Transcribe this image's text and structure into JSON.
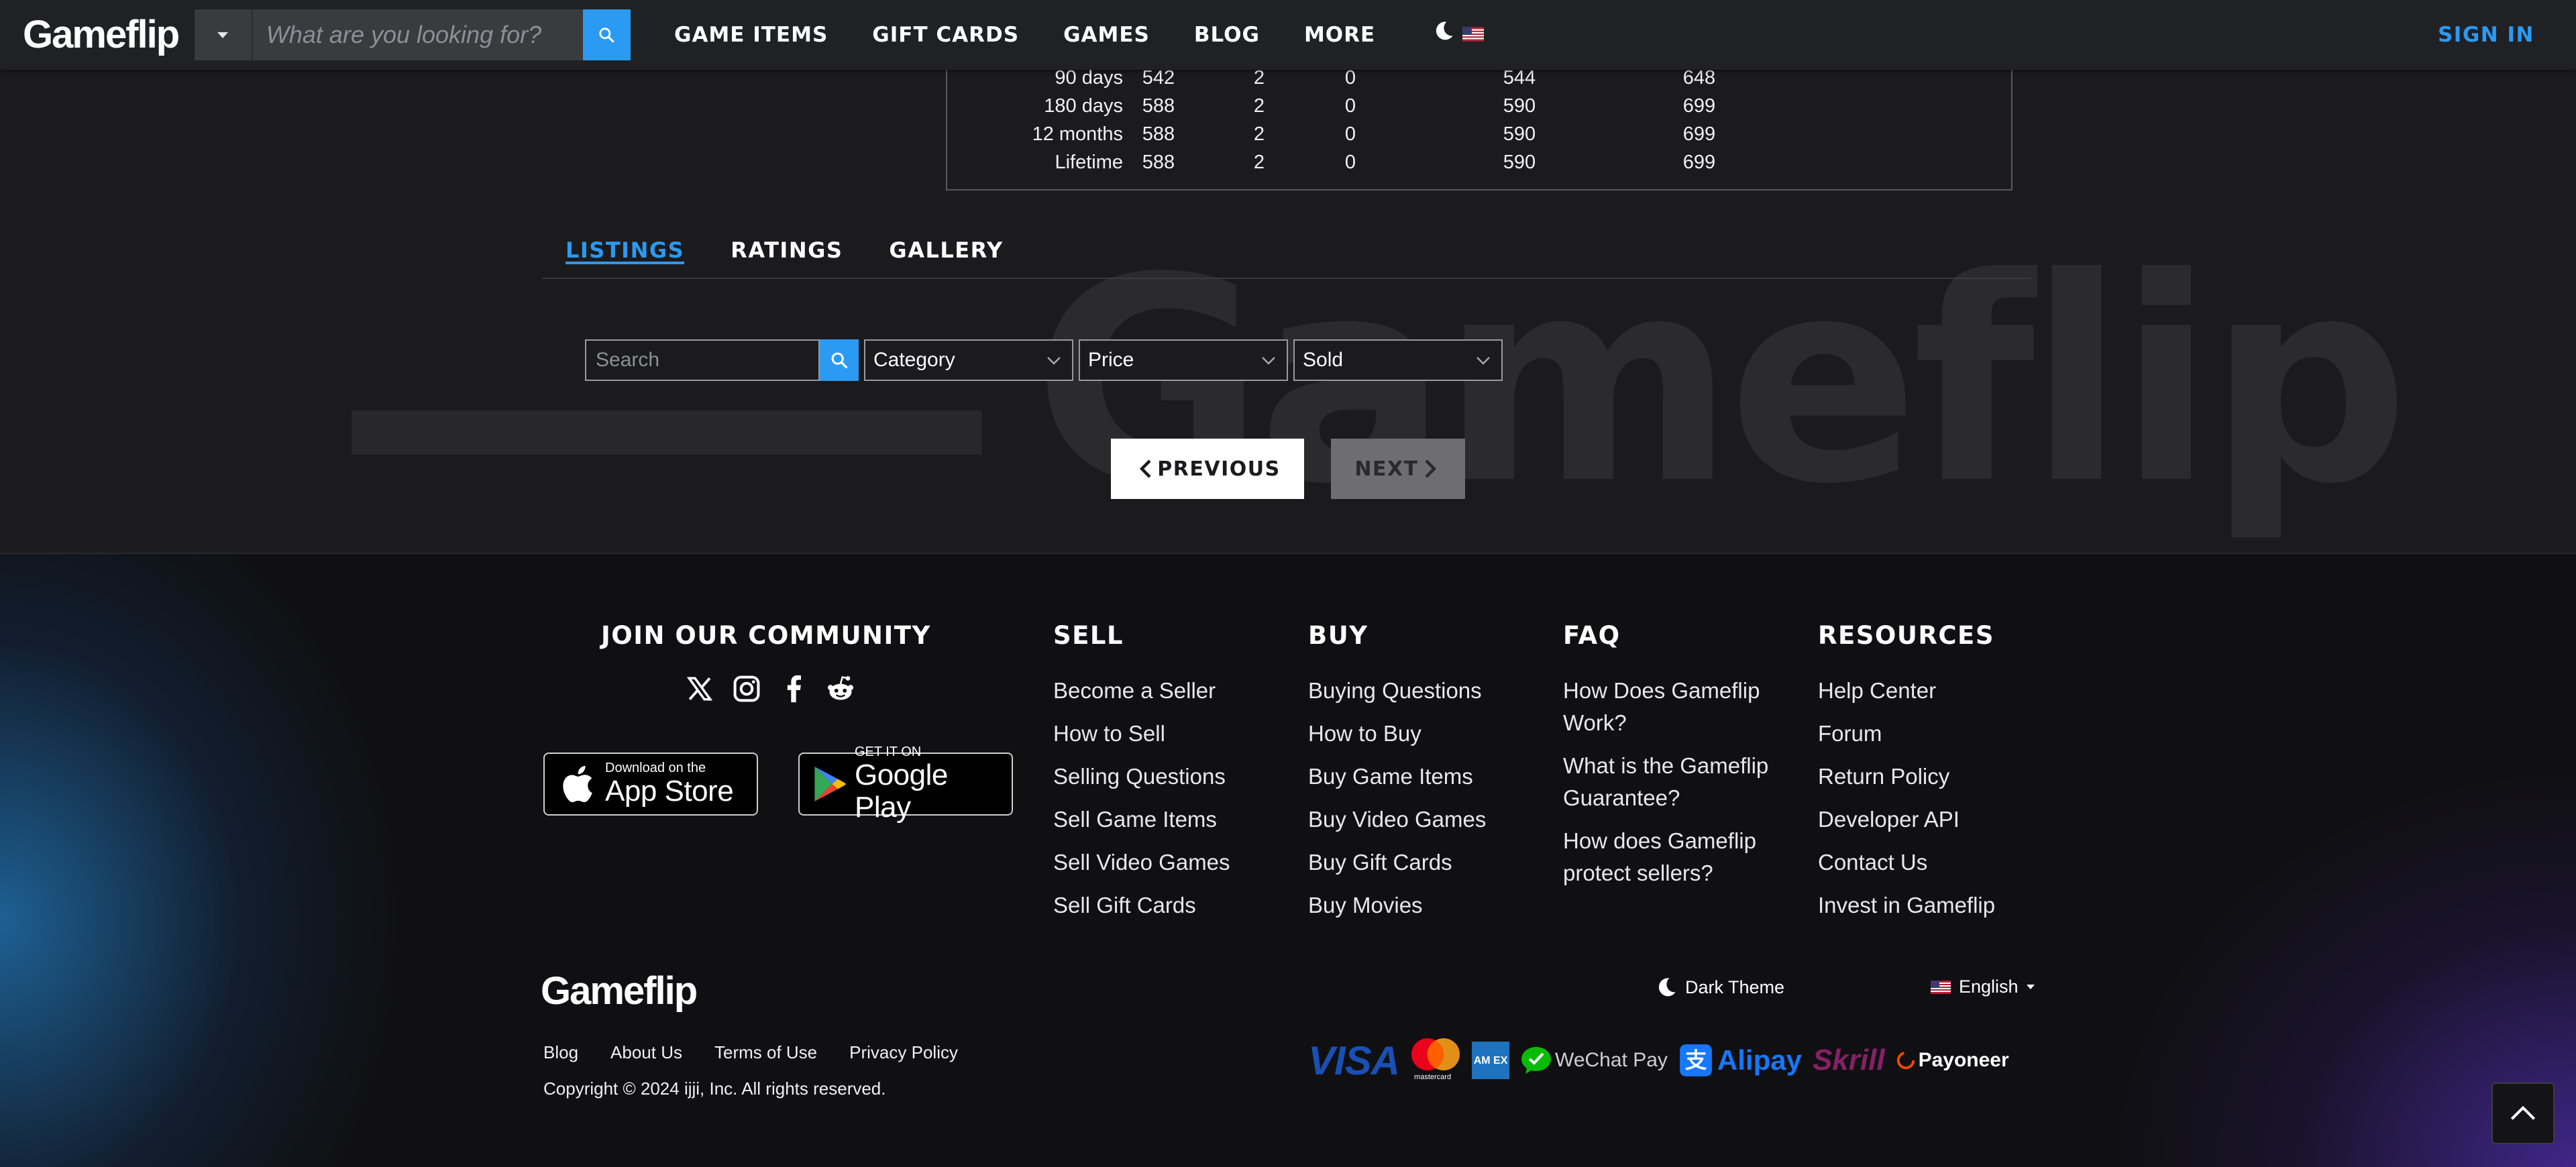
{
  "nav": {
    "logo": "Gameflip",
    "search_placeholder": "What are you looking for?",
    "links": [
      "GAME ITEMS",
      "GIFT CARDS",
      "GAMES",
      "BLOG",
      "MORE"
    ],
    "sign_in": "SIGN IN"
  },
  "stats": {
    "rows": [
      {
        "period": "90 days",
        "c1": "542",
        "c2": "2",
        "c3": "0",
        "c4": "544",
        "c5": "648"
      },
      {
        "period": "180 days",
        "c1": "588",
        "c2": "2",
        "c3": "0",
        "c4": "590",
        "c5": "699"
      },
      {
        "period": "12 months",
        "c1": "588",
        "c2": "2",
        "c3": "0",
        "c4": "590",
        "c5": "699"
      },
      {
        "period": "Lifetime",
        "c1": "588",
        "c2": "2",
        "c3": "0",
        "c4": "590",
        "c5": "699"
      }
    ]
  },
  "watermark": "Gameflip",
  "tabs": [
    "LISTINGS",
    "RATINGS",
    "GALLERY"
  ],
  "active_tab": "LISTINGS",
  "filters": {
    "search_placeholder": "Search",
    "category": "Category",
    "price": "Price",
    "sold": "Sold"
  },
  "pagination": {
    "previous": "PREVIOUS",
    "next": "NEXT"
  },
  "footer": {
    "community_heading": "JOIN OUR COMMUNITY",
    "social": [
      "x-icon",
      "instagram-icon",
      "facebook-icon",
      "reddit-icon"
    ],
    "app_store": {
      "small": "Download on the",
      "big": "App Store"
    },
    "google_play": {
      "small": "GET IT ON",
      "big": "Google Play"
    },
    "sell": {
      "heading": "SELL",
      "links": [
        "Become a Seller",
        "How to Sell",
        "Selling Questions",
        "Sell Game Items",
        "Sell Video Games",
        "Sell Gift Cards"
      ]
    },
    "buy": {
      "heading": "BUY",
      "links": [
        "Buying Questions",
        "How to Buy",
        "Buy Game Items",
        "Buy Video Games",
        "Buy Gift Cards",
        "Buy Movies"
      ]
    },
    "faq": {
      "heading": "FAQ",
      "links": [
        {
          "line1": "How Does Gameflip",
          "line2": "Work?"
        },
        {
          "line1": "What is the Gameflip",
          "line2": "Guarantee?"
        },
        {
          "line1": "How does Gameflip",
          "line2": "protect sellers?"
        }
      ]
    },
    "resources": {
      "heading": "RESOURCES",
      "links": [
        "Help Center",
        "Forum",
        "Return Policy",
        "Developer API",
        "Contact Us",
        "Invest in Gameflip"
      ]
    },
    "logo": "Gameflip",
    "bottom_links": [
      "Blog",
      "About Us",
      "Terms of Use",
      "Privacy Policy"
    ],
    "copyright": "Copyright © 2024 ijji, Inc. All rights reserved.",
    "theme_label": "Dark Theme",
    "language": "English",
    "payments": {
      "visa": "VISA",
      "mastercard": "mastercard",
      "amex": "AM EX",
      "wechat": "WeChat Pay",
      "alipay": "Alipay",
      "skrill": "Skrill",
      "payoneer": "Payoneer"
    }
  },
  "colors": {
    "accent": "#2b9af3",
    "background": "#1b1b1d",
    "nav": "#202124"
  }
}
